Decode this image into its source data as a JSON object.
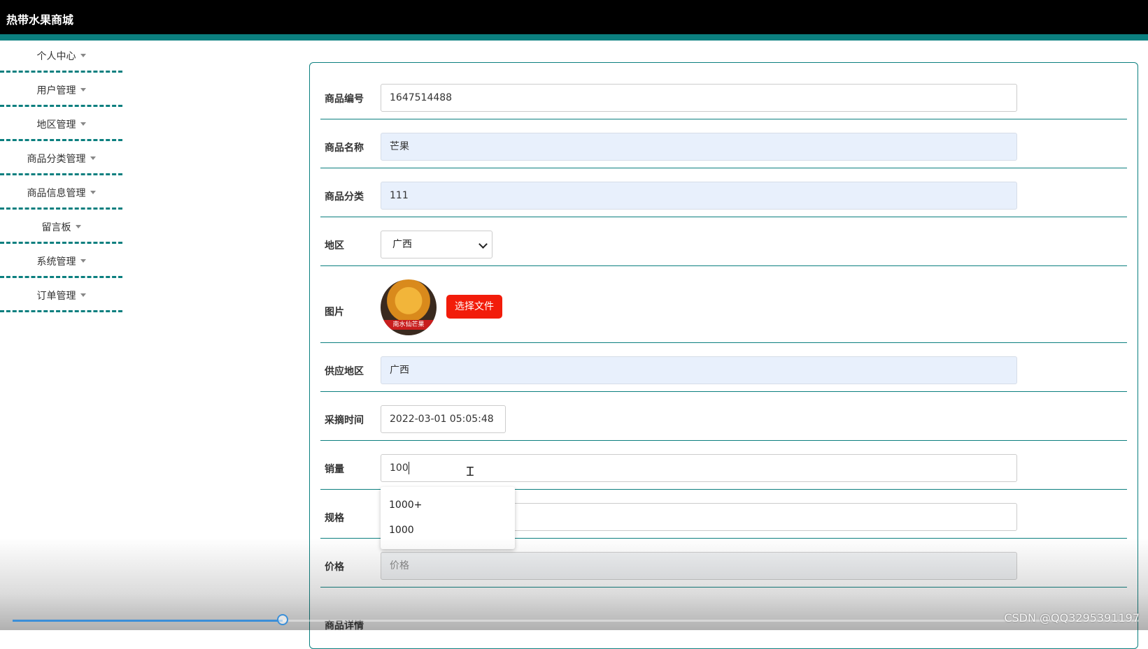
{
  "header": {
    "title": "热带水果商城"
  },
  "sidebar": {
    "items": [
      {
        "label": "个人中心"
      },
      {
        "label": "用户管理"
      },
      {
        "label": "地区管理"
      },
      {
        "label": "商品分类管理"
      },
      {
        "label": "商品信息管理"
      },
      {
        "label": "留言板"
      },
      {
        "label": "系统管理"
      },
      {
        "label": "订单管理"
      }
    ]
  },
  "form": {
    "product_no": {
      "label": "商品编号",
      "value": "1647514488"
    },
    "product_name": {
      "label": "商品名称",
      "value": "芒果"
    },
    "category": {
      "label": "商品分类",
      "value": "111"
    },
    "region": {
      "label": "地区",
      "value": "广西"
    },
    "image": {
      "label": "图片",
      "button": "选择文件",
      "thumb_text": "南水仙芒果"
    },
    "supply_region": {
      "label": "供应地区",
      "value": "广西"
    },
    "pick_time": {
      "label": "采摘时间",
      "value": "2022-03-01 05:05:48"
    },
    "sales": {
      "label": "销量",
      "value": "100"
    },
    "spec": {
      "label": "规格",
      "value": ""
    },
    "price": {
      "label": "价格",
      "placeholder": "价格"
    },
    "detail": {
      "label": "商品详情"
    }
  },
  "autocomplete": {
    "options": [
      "1000+",
      "1000"
    ]
  },
  "video": {
    "progress": 0.24
  },
  "watermark": "CSDN @QQ3295391197",
  "colors": {
    "accent": "#0b7f7f",
    "button": "#f21c0a",
    "readonly_bg": "#e8f0fc"
  }
}
